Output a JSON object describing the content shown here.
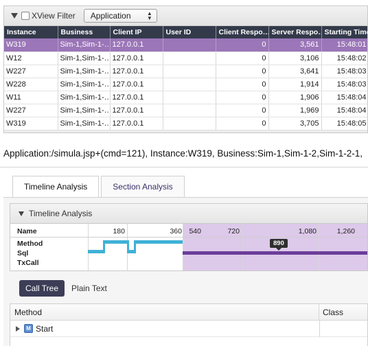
{
  "filter": {
    "xview_label": "XView Filter",
    "xview_checked": false,
    "app_select_value": "Application"
  },
  "grid": {
    "columns": [
      "Instance",
      "Business",
      "Client IP",
      "User ID",
      "Client Respo…",
      "Server Respo…",
      "Starting Time"
    ],
    "rows": [
      {
        "instance": "W319",
        "business": "Sim-1,Sim-1-…",
        "client_ip": "127.0.0.1",
        "user_id": "",
        "client_resp": "0",
        "server_resp": "3,561",
        "start": "15:48:01",
        "selected": true
      },
      {
        "instance": "W12",
        "business": "Sim-1,Sim-1-…",
        "client_ip": "127.0.0.1",
        "user_id": "",
        "client_resp": "0",
        "server_resp": "3,106",
        "start": "15:48:02",
        "selected": false
      },
      {
        "instance": "W227",
        "business": "Sim-1,Sim-1-…",
        "client_ip": "127.0.0.1",
        "user_id": "",
        "client_resp": "0",
        "server_resp": "3,641",
        "start": "15:48:03",
        "selected": false
      },
      {
        "instance": "W228",
        "business": "Sim-1,Sim-1-…",
        "client_ip": "127.0.0.1",
        "user_id": "",
        "client_resp": "0",
        "server_resp": "1,914",
        "start": "15:48:03",
        "selected": false
      },
      {
        "instance": "W11",
        "business": "Sim-1,Sim-1-…",
        "client_ip": "127.0.0.1",
        "user_id": "",
        "client_resp": "0",
        "server_resp": "1,906",
        "start": "15:48:04",
        "selected": false
      },
      {
        "instance": "W227",
        "business": "Sim-1,Sim-1-…",
        "client_ip": "127.0.0.1",
        "user_id": "",
        "client_resp": "0",
        "server_resp": "1,969",
        "start": "15:48:04",
        "selected": false
      },
      {
        "instance": "W319",
        "business": "Sim-1,Sim-1-…",
        "client_ip": "127.0.0.1",
        "user_id": "",
        "client_resp": "0",
        "server_resp": "3,705",
        "start": "15:48:05",
        "selected": false
      }
    ]
  },
  "summary": "Application:/simula.jsp+(cmd=121), Instance:W319, Business:Sim-1,Sim-1-2,Sim-1-2-1,",
  "analysis_tabs": [
    {
      "label": "Timeline Analysis",
      "active": true
    },
    {
      "label": "Section Analysis",
      "active": false
    }
  ],
  "timeline": {
    "title": "Timeline Analysis",
    "row_labels": {
      "name": "Name",
      "method": "Method",
      "sql": "Sql",
      "txcall": "TxCall"
    },
    "ticks": [
      "180",
      "360",
      "540",
      "720",
      "1,080",
      "1,260"
    ],
    "marker_value": "890"
  },
  "view_tabs": {
    "call_tree": "Call Tree",
    "plain_text": "Plain Text"
  },
  "tree": {
    "columns": {
      "method": "Method",
      "class": "Class"
    },
    "rows": [
      {
        "label": "Start",
        "icon": "M"
      }
    ]
  },
  "colors": {
    "header_bg": "#333a4a",
    "selected_row": "#9b76b8",
    "method_bar": "#3fb1d6",
    "sql_bar": "#6b3e9a",
    "timeline_shade": "#ddc9ea",
    "call_tree_btn": "#3c3d56"
  }
}
